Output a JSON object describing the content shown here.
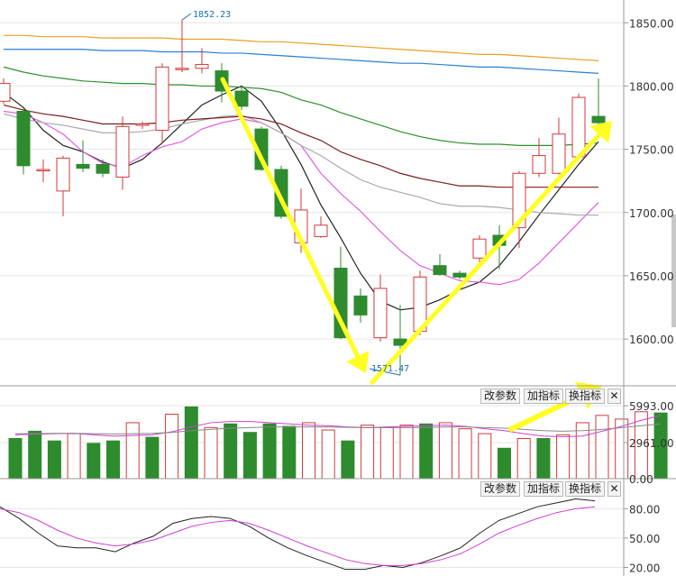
{
  "chart_data": [
    {
      "type": "candlestick",
      "axis": {
        "ylim": [
          1563,
          1868
        ],
        "ticks": [
          1850,
          1800,
          1750,
          1700,
          1650,
          1600
        ],
        "tick_labels": [
          "1850.00",
          "1800.00",
          "1750.00",
          "1700.00",
          "1650.00",
          "1600.00"
        ]
      },
      "annotations": {
        "high_label": "1852.23",
        "low_label": "1571.47"
      },
      "candles": [
        {
          "o": 1788,
          "c": 1802,
          "h": 1806,
          "l": 1786
        },
        {
          "o": 1780,
          "c": 1737,
          "h": 1782,
          "l": 1730
        },
        {
          "o": 1734,
          "c": 1734,
          "h": 1742,
          "l": 1724
        },
        {
          "o": 1717,
          "c": 1743,
          "h": 1745,
          "l": 1697
        },
        {
          "o": 1738,
          "c": 1735,
          "h": 1757,
          "l": 1732
        },
        {
          "o": 1738,
          "c": 1731,
          "h": 1742,
          "l": 1728
        },
        {
          "o": 1728,
          "c": 1768,
          "h": 1776,
          "l": 1718
        },
        {
          "o": 1770,
          "c": 1770,
          "h": 1772,
          "l": 1766
        },
        {
          "o": 1765,
          "c": 1815,
          "h": 1818,
          "l": 1755
        },
        {
          "o": 1814,
          "c": 1814,
          "h": 1852.23,
          "l": 1811
        },
        {
          "o": 1814,
          "c": 1817,
          "h": 1830,
          "l": 1810
        },
        {
          "o": 1812,
          "c": 1796,
          "h": 1818,
          "l": 1787
        },
        {
          "o": 1796,
          "c": 1784,
          "h": 1800,
          "l": 1781
        },
        {
          "o": 1766,
          "c": 1734,
          "h": 1768,
          "l": 1733
        },
        {
          "o": 1734,
          "c": 1697,
          "h": 1737,
          "l": 1695
        },
        {
          "o": 1676,
          "c": 1702,
          "h": 1719,
          "l": 1668
        },
        {
          "o": 1681,
          "c": 1690,
          "h": 1697,
          "l": 1680
        },
        {
          "o": 1656,
          "c": 1601,
          "h": 1673,
          "l": 1600
        },
        {
          "o": 1634,
          "c": 1619,
          "h": 1640,
          "l": 1613
        },
        {
          "o": 1601,
          "c": 1640,
          "h": 1651,
          "l": 1598
        },
        {
          "o": 1600,
          "c": 1595,
          "h": 1627,
          "l": 1571.47
        },
        {
          "o": 1606,
          "c": 1649,
          "h": 1654,
          "l": 1603
        },
        {
          "o": 1658,
          "c": 1651,
          "h": 1667,
          "l": 1650
        },
        {
          "o": 1652,
          "c": 1649,
          "h": 1654,
          "l": 1647
        },
        {
          "o": 1664,
          "c": 1679,
          "h": 1682,
          "l": 1660
        },
        {
          "o": 1682,
          "c": 1674,
          "h": 1690,
          "l": 1655
        },
        {
          "o": 1688,
          "c": 1731,
          "h": 1733,
          "l": 1672
        },
        {
          "o": 1731,
          "c": 1745,
          "h": 1759,
          "l": 1728
        },
        {
          "o": 1731,
          "c": 1762,
          "h": 1775,
          "l": 1730
        },
        {
          "o": 1744,
          "c": 1791,
          "h": 1794,
          "l": 1742
        },
        {
          "o": 1776,
          "c": 1771,
          "h": 1806,
          "l": 1769
        }
      ],
      "moving_averages": [
        {
          "color": "#222222",
          "values": [
            1795,
            1783,
            1765,
            1753,
            1748,
            1740,
            1735,
            1742,
            1755,
            1770,
            1785,
            1793,
            1800,
            1788,
            1765,
            1738,
            1706,
            1680,
            1652,
            1630,
            1623,
            1625,
            1631,
            1639,
            1645,
            1658,
            1677,
            1698,
            1718,
            1738,
            1756
          ]
        },
        {
          "color": "#e060e0",
          "values": [
            1780,
            1778,
            1771,
            1762,
            1748,
            1739,
            1736,
            1745,
            1752,
            1756,
            1766,
            1771,
            1774,
            1771,
            1763,
            1753,
            1731,
            1715,
            1701,
            1685,
            1670,
            1658,
            1652,
            1646,
            1645,
            1643,
            1647,
            1660,
            1676,
            1692,
            1708
          ]
        },
        {
          "color": "#aaaaaa",
          "values": [
            1778,
            1774,
            1771,
            1769,
            1766,
            1763,
            1763,
            1764,
            1766,
            1770,
            1773,
            1776,
            1777,
            1771,
            1763,
            1753,
            1745,
            1735,
            1726,
            1720,
            1716,
            1712,
            1707,
            1705,
            1705,
            1704,
            1702,
            1700,
            1699,
            1698,
            1698
          ]
        },
        {
          "color": "#7a1f1f",
          "values": [
            1785,
            1781,
            1778,
            1776,
            1773,
            1770,
            1770,
            1770,
            1771,
            1773,
            1774,
            1775,
            1776,
            1774,
            1770,
            1763,
            1757,
            1748,
            1742,
            1737,
            1731,
            1727,
            1724,
            1721,
            1721,
            1720,
            1720,
            1720,
            1720,
            1720,
            1720
          ]
        },
        {
          "color": "#2f8f2f",
          "values": [
            1815,
            1811,
            1808,
            1806,
            1804,
            1803,
            1802,
            1802,
            1801,
            1801,
            1800,
            1800,
            1799,
            1798,
            1795,
            1789,
            1785,
            1779,
            1774,
            1769,
            1764,
            1760,
            1757,
            1755,
            1754,
            1754,
            1753,
            1753,
            1753,
            1754,
            1755
          ]
        },
        {
          "color": "#2a7fd4",
          "values": [
            1829,
            1829,
            1829,
            1829,
            1829,
            1828,
            1828,
            1828,
            1827,
            1827,
            1827,
            1826,
            1826,
            1825,
            1824,
            1823,
            1822,
            1821,
            1820,
            1819,
            1818,
            1818,
            1817,
            1816,
            1815,
            1815,
            1814,
            1813,
            1812,
            1811,
            1810
          ]
        },
        {
          "color": "#e8a020",
          "values": [
            1840,
            1840,
            1839,
            1839,
            1839,
            1838,
            1838,
            1838,
            1838,
            1837,
            1837,
            1837,
            1836,
            1835,
            1835,
            1834,
            1833,
            1832,
            1831,
            1830,
            1829,
            1828,
            1827,
            1826,
            1825,
            1825,
            1824,
            1823,
            1822,
            1821,
            1820
          ]
        }
      ]
    },
    {
      "type": "bar",
      "axis": {
        "ylim": [
          0,
          6300
        ],
        "ticks": [
          5993,
          2961,
          0
        ],
        "tick_labels": [
          "5993.00",
          "2961.00",
          "0.00"
        ]
      },
      "volumes": [
        3300,
        3900,
        3100,
        3700,
        2900,
        3100,
        4600,
        3400,
        5300,
        5900,
        4200,
        4500,
        3800,
        4500,
        4300,
        4600,
        4000,
        3100,
        4400,
        4200,
        4400,
        4500,
        4600,
        4100,
        3700,
        2500,
        3300,
        3300,
        3600,
        4600,
        5200,
        4900,
        5500,
        5400
      ],
      "up": [
        false,
        false,
        false,
        true,
        false,
        false,
        true,
        false,
        true,
        false,
        true,
        false,
        false,
        false,
        false,
        true,
        true,
        false,
        true,
        true,
        true,
        false,
        true,
        true,
        true,
        false,
        true,
        false,
        true,
        true,
        true,
        true,
        true,
        false
      ],
      "ma_lines": [
        {
          "color": "#d040d0",
          "values": [
            3600,
            3650,
            3700,
            3720,
            3600,
            3500,
            3550,
            3600,
            3850,
            4250,
            4600,
            4700,
            4700,
            4600,
            4500,
            4400,
            4350,
            4250,
            4200,
            4250,
            4300,
            4350,
            4400,
            4300,
            4100,
            3950,
            3700,
            3500,
            3450,
            3500,
            3900,
            4300,
            4800,
            5200
          ]
        },
        {
          "color": "#888888",
          "values": [
            3700,
            3700,
            3720,
            3720,
            3700,
            3680,
            3700,
            3720,
            3800,
            3950,
            4050,
            4150,
            4200,
            4250,
            4250,
            4250,
            4250,
            4220,
            4200,
            4200,
            4200,
            4200,
            4250,
            4250,
            4200,
            4150,
            4050,
            3950,
            3900,
            3950,
            4050,
            4200,
            4350,
            4500
          ]
        }
      ],
      "buttons": [
        "改参数",
        "加指标",
        "换指标"
      ]
    },
    {
      "type": "line",
      "axis": {
        "ylim": [
          14,
          96
        ],
        "ticks": [
          80,
          50,
          20
        ],
        "tick_labels": [
          "80.00",
          "50.00",
          "20.00"
        ]
      },
      "series": [
        {
          "color": "#222222",
          "values": [
            82,
            70,
            55,
            42,
            40,
            40,
            36,
            45,
            52,
            65,
            70,
            72,
            70,
            62,
            50,
            40,
            32,
            25,
            18,
            18,
            22,
            20,
            25,
            32,
            40,
            55,
            68,
            75,
            82,
            86,
            90,
            88
          ]
        },
        {
          "color": "#d040d0",
          "values": [
            80,
            76,
            68,
            58,
            50,
            45,
            42,
            44,
            48,
            55,
            62,
            66,
            68,
            65,
            58,
            50,
            42,
            35,
            28,
            24,
            22,
            22,
            24,
            28,
            34,
            44,
            55,
            63,
            70,
            76,
            80,
            82
          ]
        }
      ],
      "buttons": [
        "改参数",
        "加指标",
        "换指标"
      ]
    }
  ]
}
